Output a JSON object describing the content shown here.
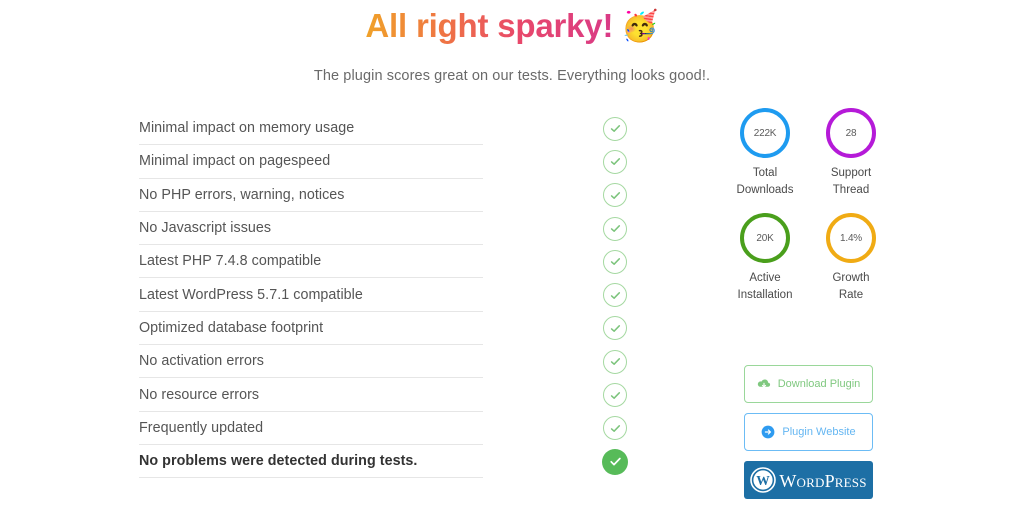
{
  "header": {
    "title": "All right sparky!",
    "emoji": "🥳",
    "emoji_name": "partying-face-emoji",
    "subtitle": "The plugin scores great on our tests. Everything looks good!.",
    "title_gradient_start": "#f0a229",
    "title_gradient_end": "#d93a87"
  },
  "checklist": {
    "items": [
      {
        "label": "Minimal impact on memory usage",
        "status": "pass"
      },
      {
        "label": "Minimal impact on pagespeed",
        "status": "pass"
      },
      {
        "label": "No PHP errors, warning, notices",
        "status": "pass"
      },
      {
        "label": "No Javascript issues",
        "status": "pass"
      },
      {
        "label": "Latest PHP 7.4.8 compatible",
        "status": "pass"
      },
      {
        "label": "Latest WordPress 5.7.1 compatible",
        "status": "pass"
      },
      {
        "label": "Optimized database footprint",
        "status": "pass"
      },
      {
        "label": "No activation errors",
        "status": "pass"
      },
      {
        "label": "No resource errors",
        "status": "pass"
      },
      {
        "label": "Frequently updated",
        "status": "pass"
      },
      {
        "label": "No problems were detected during tests.",
        "status": "pass-summary"
      }
    ],
    "check_outline_color": "#a5d9a1",
    "check_solid_color": "#57bb59"
  },
  "stats": [
    {
      "value": "222K",
      "label_line1": "Total",
      "label_line2": "Downloads",
      "color": "#1e9bf0",
      "name": "total-downloads"
    },
    {
      "value": "28",
      "label_line1": "Support",
      "label_line2": "Thread",
      "color": "#b51ad8",
      "name": "support-thread"
    },
    {
      "value": "20K",
      "label_line1": "Active",
      "label_line2": "Installation",
      "color": "#4a9f1c",
      "name": "active-installation"
    },
    {
      "value": "1.4%",
      "label_line1": "Growth",
      "label_line2": "Rate",
      "color": "#f0ab14",
      "name": "growth-rate"
    }
  ],
  "actions": {
    "download_label": "Download Plugin",
    "download_icon": "cloud-download-icon",
    "download_color": "#7fc87f",
    "website_label": "Plugin Website",
    "website_icon": "arrow-circle-right-icon",
    "website_color": "#64b6f2",
    "wordpress_label": "WordPress",
    "wordpress_icon": "wordpress-logo-icon",
    "wordpress_bg": "#1d6fa5"
  }
}
